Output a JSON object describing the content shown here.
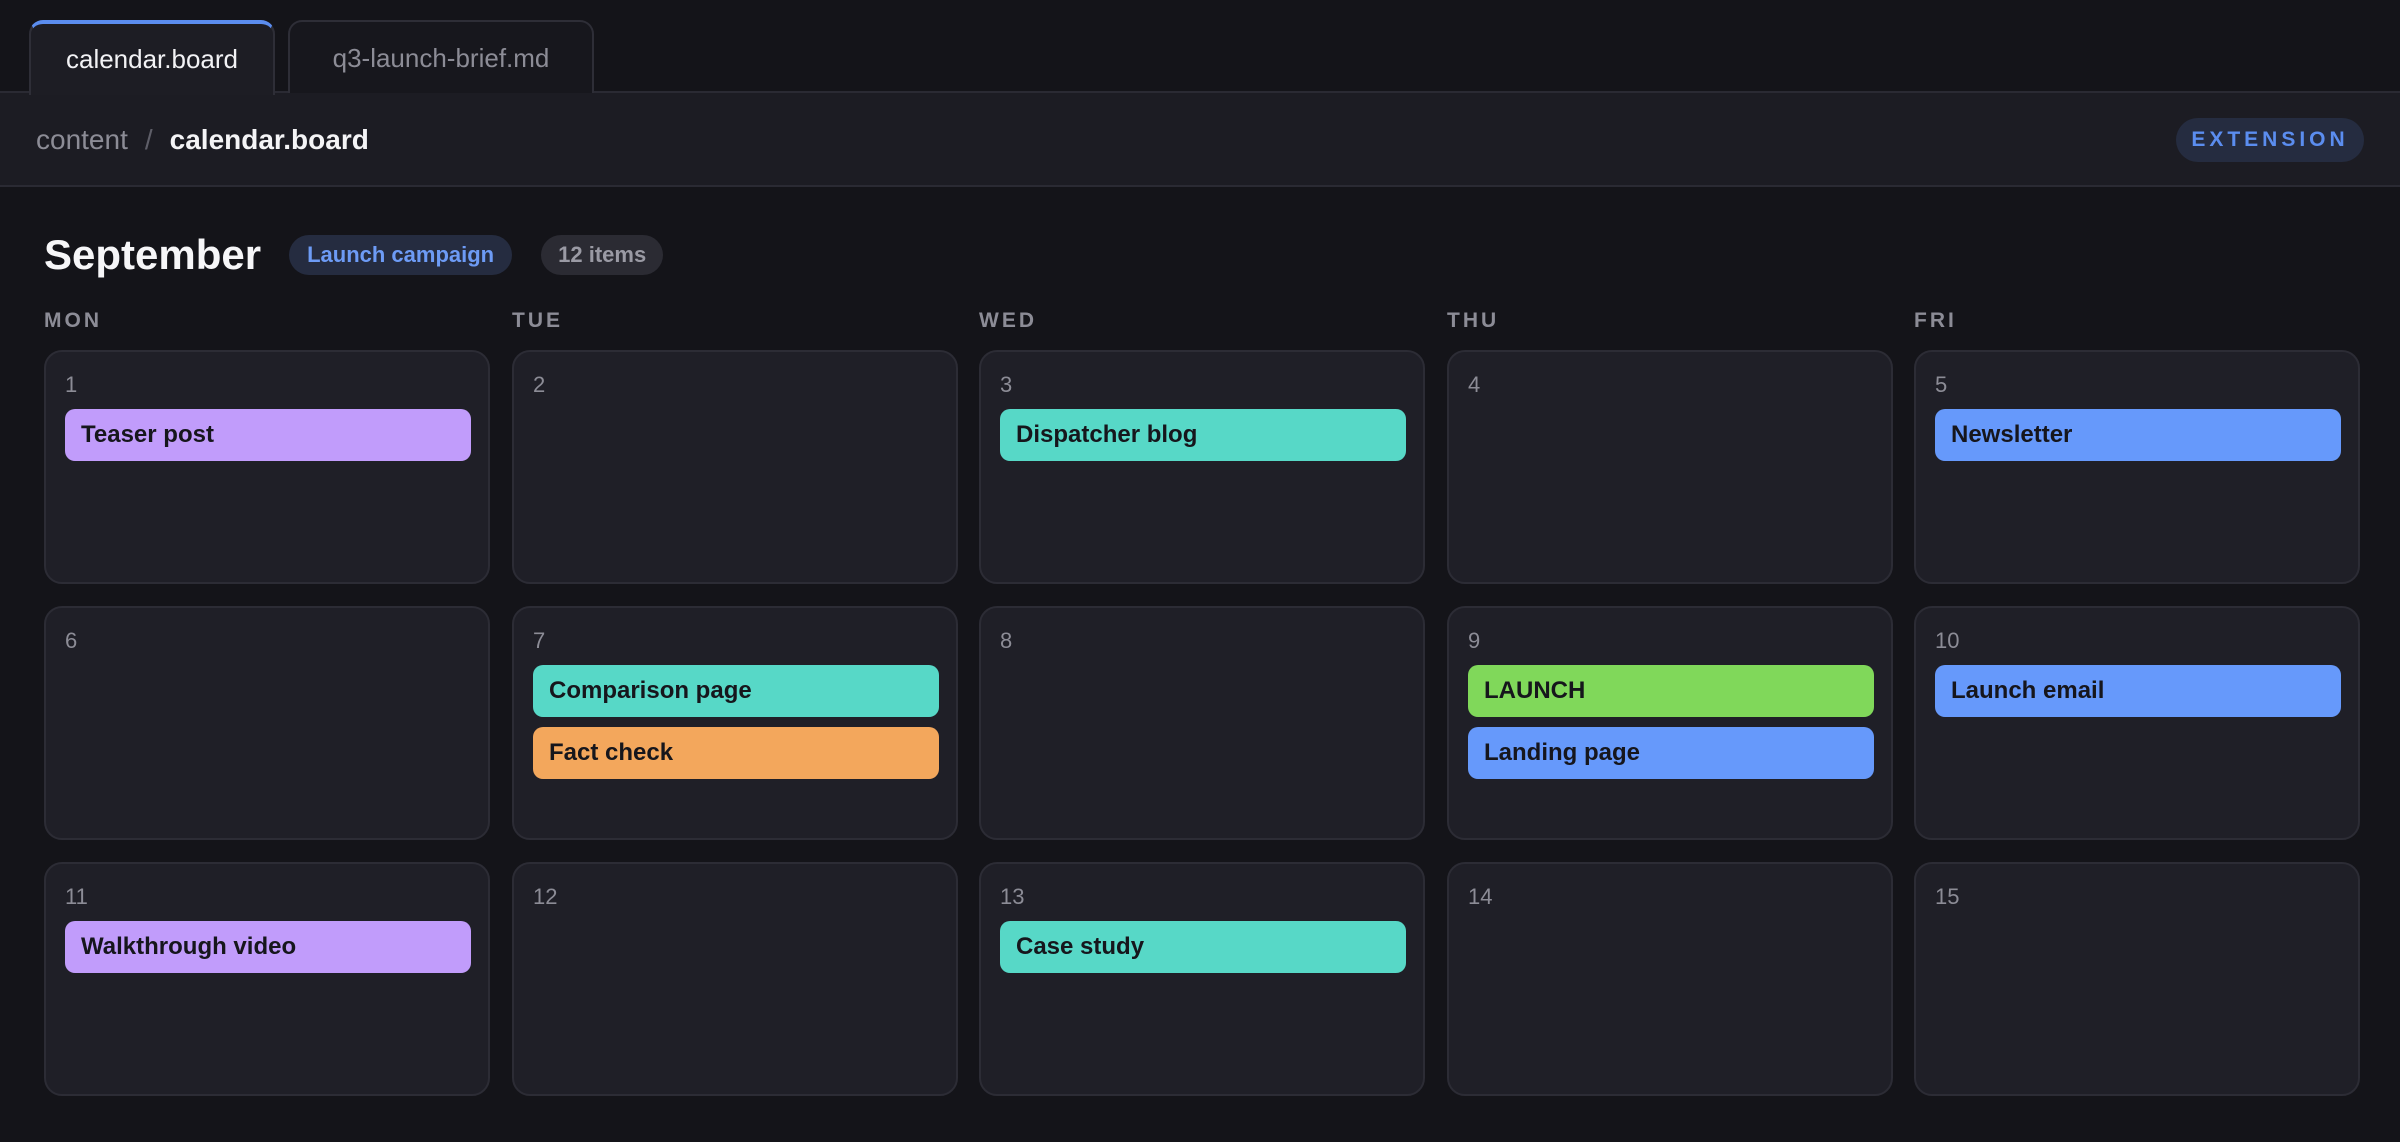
{
  "tabs": [
    {
      "label": "calendar.board",
      "active": true
    },
    {
      "label": "q3-launch-brief.md",
      "active": false
    }
  ],
  "breadcrumb": {
    "parent": "content",
    "separator": "/",
    "current": "calendar.board"
  },
  "badge": {
    "label": "EXTENSION"
  },
  "calendar": {
    "month": "September",
    "campaign": "Launch campaign",
    "count": "12 items",
    "weekdays": [
      "MON",
      "TUE",
      "WED",
      "THU",
      "FRI"
    ],
    "days": [
      {
        "num": "1",
        "events": [
          {
            "label": "Teaser post",
            "color": "#c19cfb"
          }
        ]
      },
      {
        "num": "2",
        "events": []
      },
      {
        "num": "3",
        "events": [
          {
            "label": "Dispatcher blog",
            "color": "#57d8c7"
          }
        ]
      },
      {
        "num": "4",
        "events": []
      },
      {
        "num": "5",
        "events": [
          {
            "label": "Newsletter",
            "color": "#6699fb"
          }
        ]
      },
      {
        "num": "6",
        "events": []
      },
      {
        "num": "7",
        "events": [
          {
            "label": "Comparison page",
            "color": "#57d8c7"
          },
          {
            "label": "Fact check",
            "color": "#f3a75c"
          }
        ]
      },
      {
        "num": "8",
        "events": []
      },
      {
        "num": "9",
        "events": [
          {
            "label": "LAUNCH",
            "color": "#80d85a"
          },
          {
            "label": "Landing page",
            "color": "#6699fb"
          }
        ]
      },
      {
        "num": "10",
        "events": [
          {
            "label": "Launch email",
            "color": "#6699fb"
          }
        ]
      },
      {
        "num": "11",
        "events": [
          {
            "label": "Walkthrough video",
            "color": "#c19cfb"
          }
        ]
      },
      {
        "num": "12",
        "events": []
      },
      {
        "num": "13",
        "events": [
          {
            "label": "Case study",
            "color": "#57d8c7"
          }
        ]
      },
      {
        "num": "14",
        "events": []
      },
      {
        "num": "15",
        "events": []
      }
    ]
  }
}
